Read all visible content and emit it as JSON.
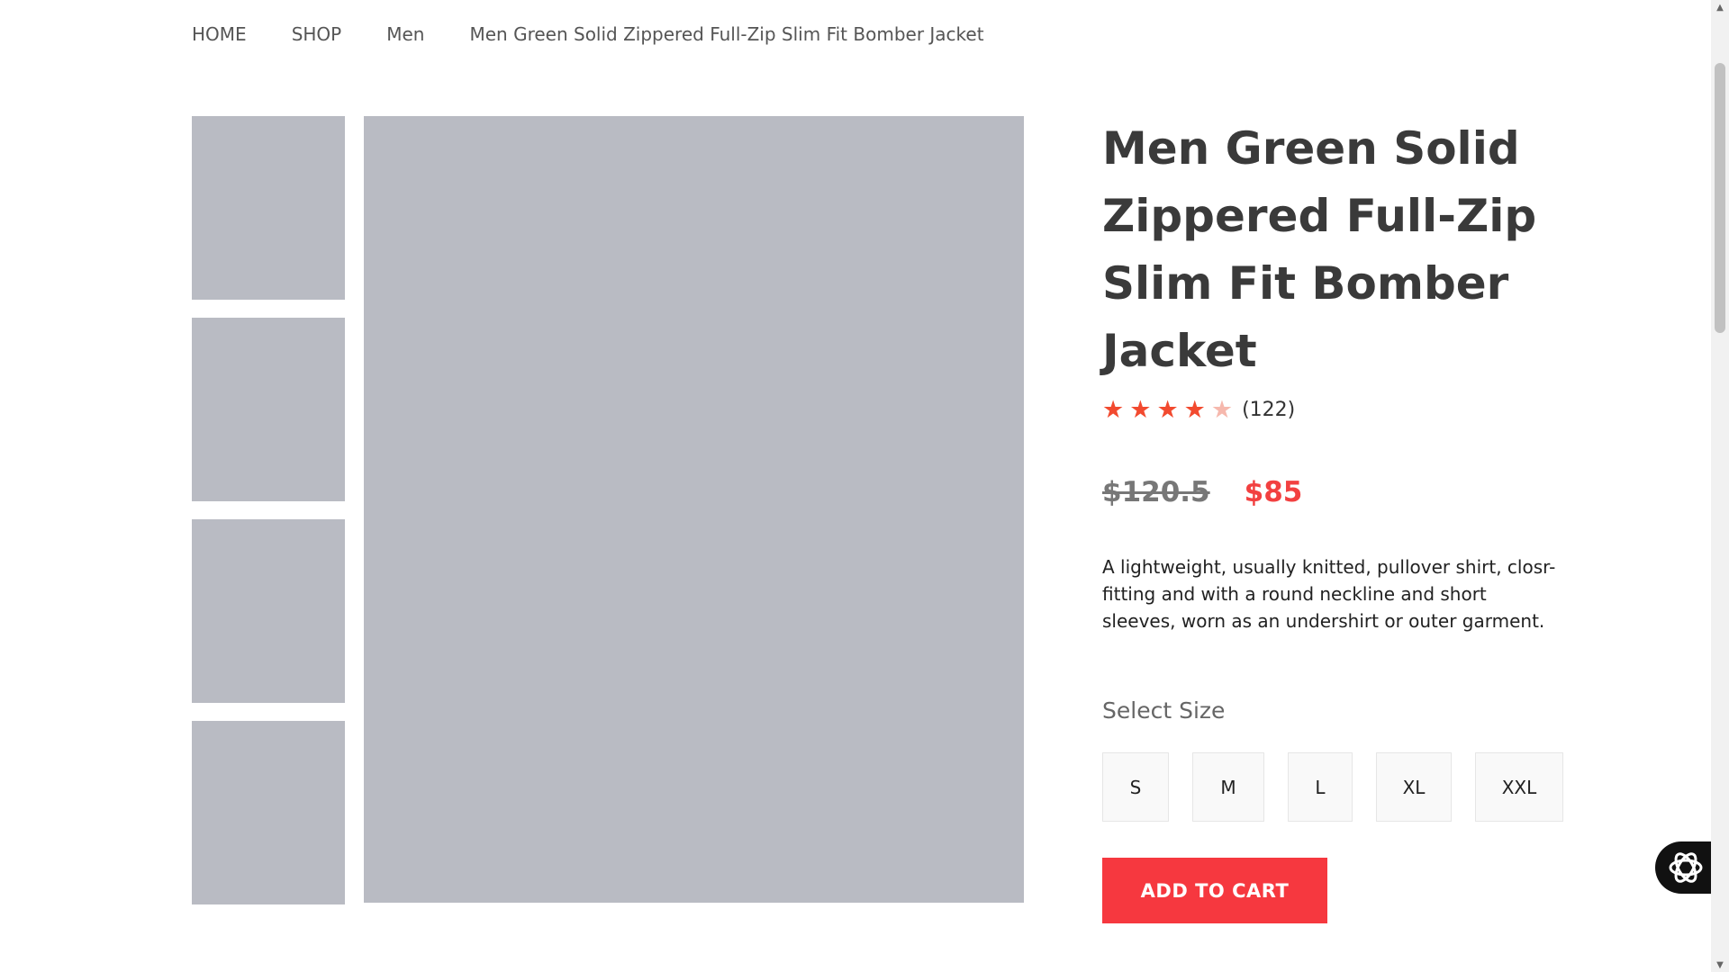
{
  "breadcrumb": {
    "items": [
      "HOME",
      "SHOP",
      "Men",
      "Men Green Solid Zippered Full-Zip Slim Fit Bomber Jacket"
    ]
  },
  "product": {
    "title": "Men Green Solid Zippered Full-Zip Slim Fit Bomber Jacket",
    "rating": 4,
    "rating_max": 5,
    "review_count": "(122)",
    "old_price": "$120.5",
    "new_price": "$85",
    "description": "A lightweight, usually knitted, pullover shirt, closr-fitting and with a round neckline and short sleeves, worn as an undershirt or outer garment.",
    "size_label": "Select Size",
    "sizes": [
      "S",
      "M",
      "L",
      "XL",
      "XXL"
    ],
    "add_to_cart": "ADD TO CART"
  },
  "colors": {
    "accent": "#f6383f",
    "price": "#f24040",
    "star": "#f24a2f",
    "image_bg": "#b9bbc3"
  },
  "icons": {
    "widget": "chat-assistant-icon",
    "star": "star-icon"
  }
}
